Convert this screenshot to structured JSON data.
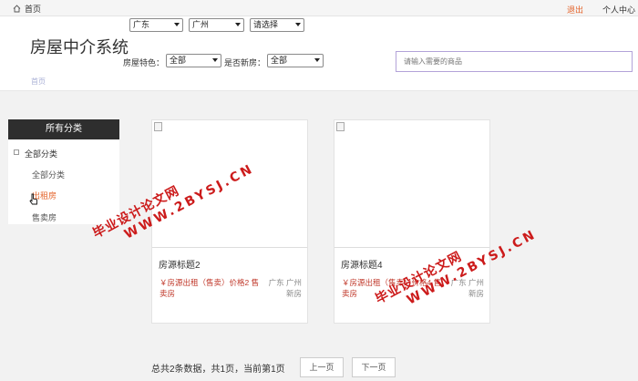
{
  "topbar": {
    "home": "首页",
    "logout": "退出",
    "user_center": "个人中心"
  },
  "header": {
    "site_title": "房屋中介系统",
    "breadcrumb": "首页",
    "province": "广东",
    "city": "广州",
    "district": "请选择",
    "feature_label": "房屋特色：",
    "feature_value": "全部",
    "new_label": "是否新房：",
    "new_value": "全部",
    "search_placeholder": "请输入需要的商品"
  },
  "sidebar": {
    "title": "所有分类",
    "root": "全部分类",
    "items": [
      "全部分类",
      "出租房",
      "售卖房"
    ]
  },
  "cards": [
    {
      "title": "房源标题2",
      "price": "￥房源出租（售卖）价格2 售卖房",
      "location": "广东 广州 新房"
    },
    {
      "title": "房源标题4",
      "price": "￥房源出租（售卖）价格4 售卖房",
      "location": "广东 广州 新房"
    }
  ],
  "pager": {
    "summary": "总共2条数据，共1页，当前第1页",
    "prev": "上一页",
    "next": "下一页"
  },
  "watermark": {
    "line1": "毕业设计论文网",
    "line2": "WWW.2BYSJ.CN"
  }
}
